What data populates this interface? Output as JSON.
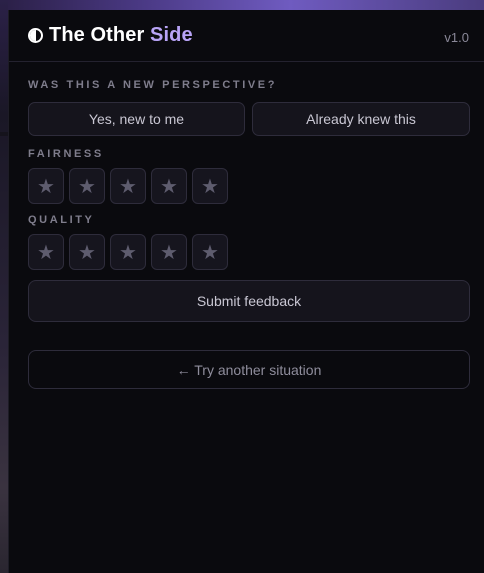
{
  "header": {
    "title_main": "The Other",
    "title_accent": "Side",
    "version": "v1.0",
    "icon": "half-circle-icon"
  },
  "perspective": {
    "label": "WAS THIS A NEW PERSPECTIVE?",
    "yes_label": "Yes, new to me",
    "no_label": "Already knew this"
  },
  "fairness": {
    "label": "FAIRNESS",
    "stars": [
      "★",
      "★",
      "★",
      "★",
      "★"
    ],
    "rating": 0
  },
  "quality": {
    "label": "QUALITY",
    "stars": [
      "★",
      "★",
      "★",
      "★",
      "★"
    ],
    "rating": 0
  },
  "submit_label": "Submit feedback",
  "try_another_label": "← Try another situation",
  "colors": {
    "accent": "#b9a4f7",
    "background": "#0a0a0e",
    "button_bg": "#15141c",
    "border": "#2e2c3b"
  }
}
